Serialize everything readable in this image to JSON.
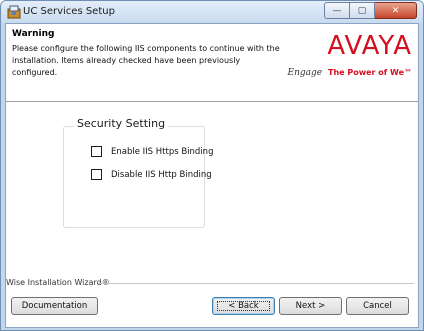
{
  "window": {
    "title": "UC Services Setup",
    "caption": {
      "minimize": "—",
      "maximize": "▢",
      "close": "✕"
    }
  },
  "header": {
    "title": "Warning",
    "description": "Please configure the following IIS components to continue with the installation. Items already checked have been previously configured.",
    "logo": {
      "brand": "AVAYA",
      "tagline_script": "Engage",
      "tagline": "The Power of We™"
    }
  },
  "group": {
    "label": "Security Setting",
    "options": [
      {
        "label": "Enable IIS Https Binding",
        "checked": false
      },
      {
        "label": "Disable IIS Http Binding",
        "checked": false
      }
    ]
  },
  "footer": {
    "brand": "Wise Installation Wizard®",
    "buttons": {
      "documentation": "Documentation",
      "back": "< Back",
      "next": "Next >",
      "cancel": "Cancel"
    }
  },
  "colors": {
    "accent": "#d40f1f",
    "window_frame": "#c3d7ec"
  }
}
